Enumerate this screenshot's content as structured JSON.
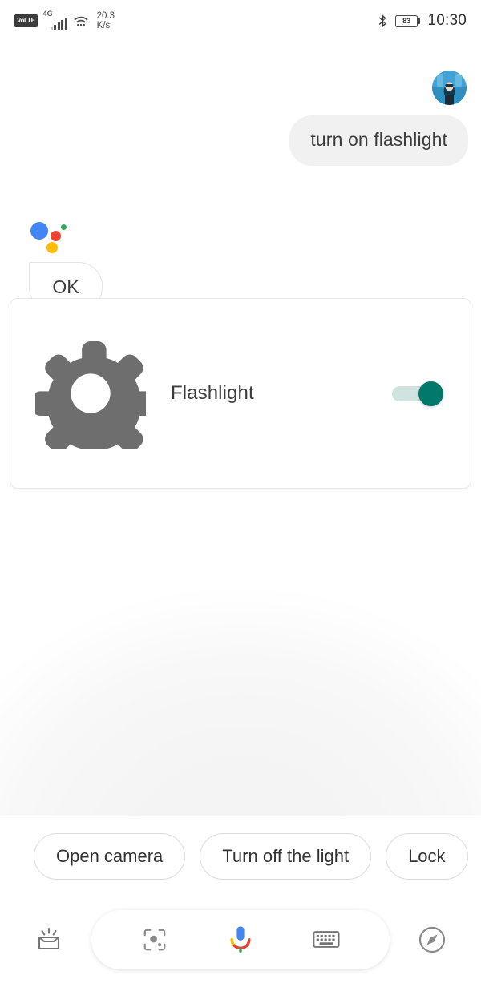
{
  "status_bar": {
    "volte_label": "VoLTE",
    "network_type": "4G",
    "network_speed_value": "20.3",
    "network_speed_unit": "K/s",
    "wifi_icon": "wifi-icon",
    "bluetooth_icon": "bluetooth-icon",
    "battery_percent": "83",
    "time": "10:30"
  },
  "conversation": {
    "user_message": "turn on flashlight",
    "avatar_icon": "user-avatar",
    "assistant_logo_icon": "google-assistant-logo",
    "assistant_reply": "OK"
  },
  "device_card": {
    "icon": "gear-icon",
    "label": "Flashlight",
    "toggle_state": "on",
    "toggle_on_color": "#00796b",
    "toggle_track_color": "#cfe3e0"
  },
  "suggestions": [
    {
      "label": "Open camera"
    },
    {
      "label": "Turn off the light"
    },
    {
      "label": "Lock"
    }
  ],
  "bottom_bar": {
    "snapshot_icon": "snapshot-inbox-icon",
    "lens_icon": "google-lens-icon",
    "mic_icon": "google-mic-icon",
    "keyboard_icon": "keyboard-icon",
    "explore_icon": "compass-explore-icon"
  },
  "colors": {
    "google_blue": "#4285f4",
    "google_red": "#ea4335",
    "google_yellow": "#fbbc05",
    "google_green": "#34a853",
    "bubble_gray": "#f1f1f1",
    "gear_gray": "#6e6e6e"
  }
}
